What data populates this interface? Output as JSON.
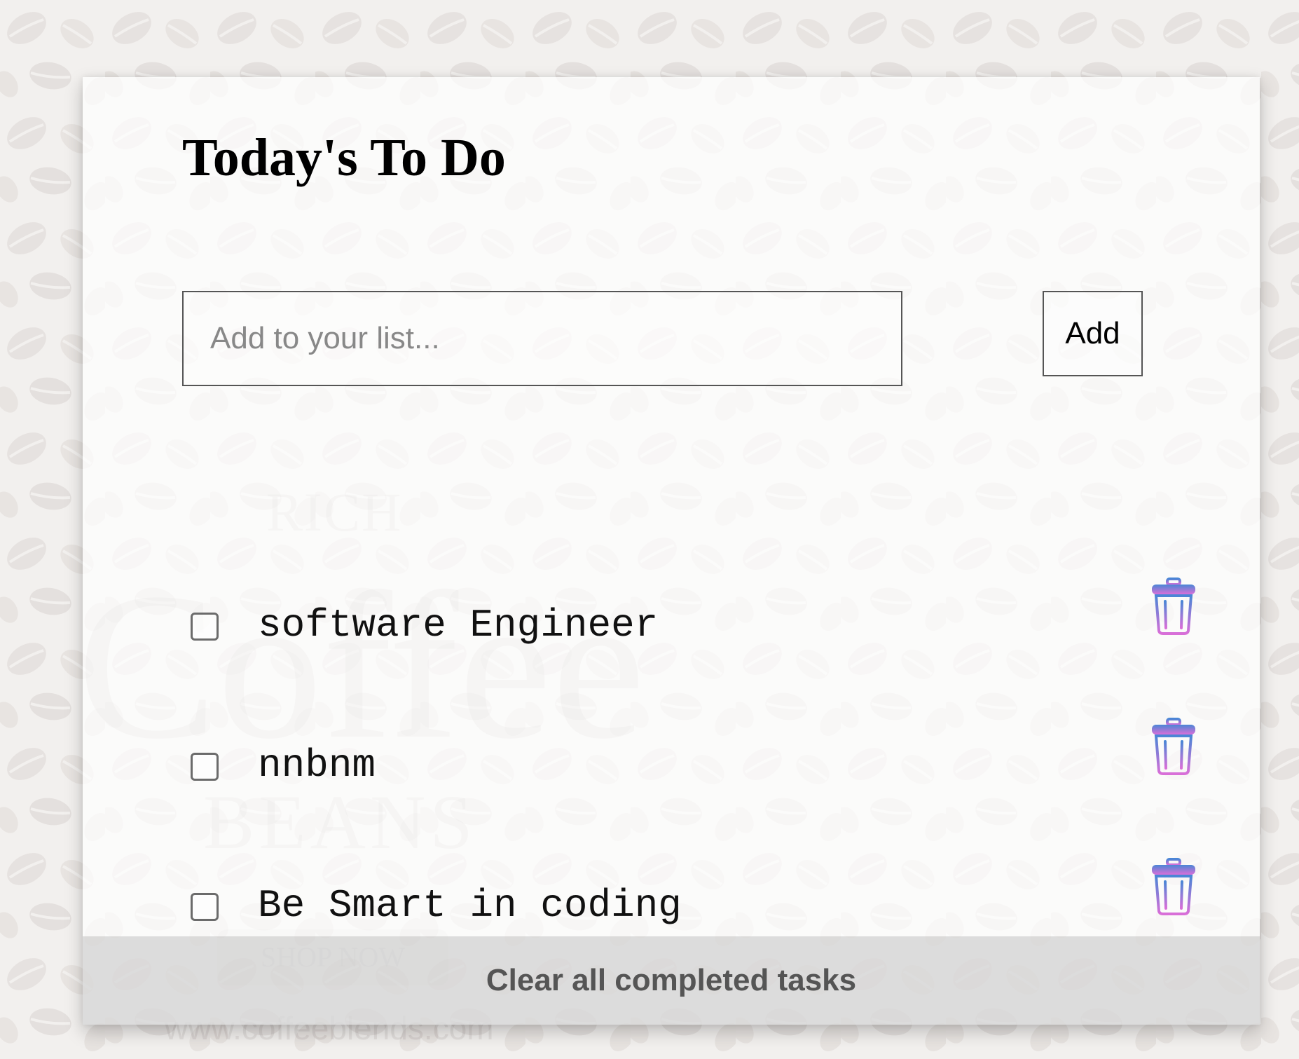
{
  "background": {
    "watermark": {
      "line1": "RICH",
      "line2": "Coffee",
      "line3": "BEANS",
      "button": "SHOP NOW",
      "url": "www.coffeeblends.com"
    }
  },
  "todo": {
    "title": "Today's To Do",
    "input": {
      "value": "",
      "placeholder": "Add to your list..."
    },
    "add_label": "Add",
    "tasks": [
      {
        "text": "software Engineer",
        "checked": false
      },
      {
        "text": "nnbnm",
        "checked": false
      },
      {
        "text": "Be Smart in coding",
        "checked": false
      }
    ],
    "clear_label": "Clear all completed tasks"
  },
  "icons": {
    "delete": "trash-icon"
  },
  "colors": {
    "trash_top": "#4a86d6",
    "trash_bottom": "#d96fd8",
    "footer_text": "#555555"
  }
}
